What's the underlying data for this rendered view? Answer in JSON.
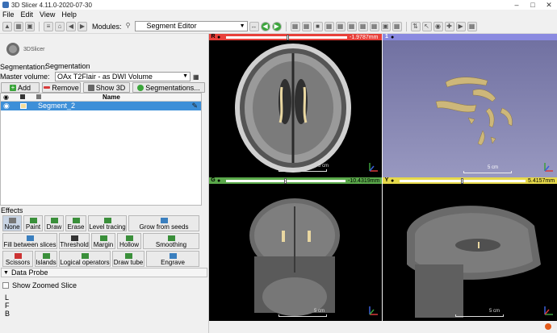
{
  "window": {
    "title": "3D Slicer 4.11.0-2020-07-30"
  },
  "menubar": {
    "items": [
      "File",
      "Edit",
      "View",
      "Help"
    ]
  },
  "toolbar": {
    "modules_label": "Modules:",
    "module_selected": "Segment Editor"
  },
  "logo": {
    "text": "3DSlicer"
  },
  "segmentation": {
    "label": "Segmentation:",
    "value": "Segmentation"
  },
  "master_volume": {
    "label": "Master volume:",
    "value": "OAx T2Flair - as DWI Volume"
  },
  "segment_buttons": {
    "add": "Add",
    "remove": "Remove",
    "show3d": "Show 3D",
    "segmentations": "Segmentations..."
  },
  "table": {
    "header_name": "Name",
    "rows": [
      {
        "name": "Segment_2",
        "color": "#f3dc9b"
      }
    ]
  },
  "effects": {
    "title": "Effects",
    "items": [
      "None",
      "Paint",
      "Draw",
      "Erase",
      "Level tracing",
      "Grow from seeds",
      "Fill between slices",
      "Threshold",
      "Margin",
      "Hollow",
      "Smoothing",
      "Scissors",
      "Islands",
      "Logical operators",
      "Draw tube",
      "Engrave"
    ]
  },
  "data_probe": {
    "title": "Data Probe",
    "show_zoomed": "Show Zoomed Slice",
    "letters": [
      "L",
      "F",
      "B"
    ]
  },
  "views": {
    "red": {
      "label": "R",
      "value": "-1.9787mm",
      "scale": "5 cm",
      "color": "#e8403a"
    },
    "view3d": {
      "label": "1",
      "scale": "5 cm",
      "color": "#8a8ae0"
    },
    "green": {
      "label": "G",
      "value": "-10.4319mm",
      "scale": "5 cm",
      "color": "#5aa84a"
    },
    "yellow": {
      "label": "Y",
      "value": "5.4157mm",
      "scale": "5 cm",
      "color": "#e6d94a"
    }
  },
  "colors": {
    "segment": "#e9d7a1",
    "selection": "#3d8fd8",
    "background_3d": "#7f7fa8"
  }
}
